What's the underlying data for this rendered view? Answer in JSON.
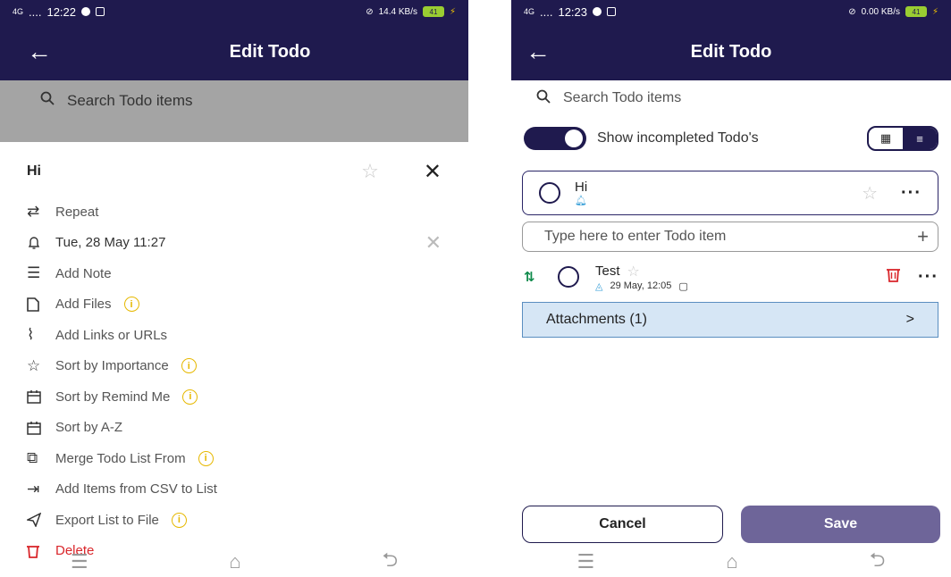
{
  "left": {
    "status": {
      "time": "12:22",
      "network": "4G",
      "signal": "....",
      "battery": "41",
      "speed": "14.4 KB/s"
    },
    "appbar": {
      "title": "Edit Todo"
    },
    "search": {
      "placeholder": "Search Todo items"
    },
    "todo": {
      "name": "Hi"
    },
    "menu": [
      {
        "label": "Repeat",
        "icon": "repeat-icon",
        "info": false
      },
      {
        "label": "Tue, 28 May 11:27",
        "icon": "bell-icon",
        "info": false
      },
      {
        "label": "Add Note",
        "icon": "note-icon",
        "info": false
      },
      {
        "label": "Add Files",
        "icon": "file-icon",
        "info": true
      },
      {
        "label": "Add Links or URLs",
        "icon": "paperclip-icon",
        "info": false
      },
      {
        "label": "Sort by Importance",
        "icon": "star-icon",
        "info": true
      },
      {
        "label": "Sort by Remind Me",
        "icon": "calendar-icon",
        "info": true
      },
      {
        "label": "Sort by A-Z",
        "icon": "calendar-icon",
        "info": false
      },
      {
        "label": "Merge Todo List From",
        "icon": "merge-icon",
        "info": true
      },
      {
        "label": "Add Items from CSV to List",
        "icon": "import-icon",
        "info": false
      },
      {
        "label": "Export List to File",
        "icon": "send-icon",
        "info": true
      },
      {
        "label": "Delete",
        "icon": "trash-icon",
        "info": false
      }
    ]
  },
  "right": {
    "status": {
      "time": "12:23",
      "network": "4G",
      "signal": "....",
      "battery": "41",
      "speed": "0.00 KB/s"
    },
    "appbar": {
      "title": "Edit Todo"
    },
    "search": {
      "placeholder": "Search Todo items"
    },
    "toggle": {
      "label": "Show incompleted Todo's",
      "on": true
    },
    "current_todo": {
      "name": "Hi"
    },
    "entry": {
      "placeholder": "Type here to enter Todo item"
    },
    "item": {
      "name": "Test",
      "reminder": "29 May, 12:05"
    },
    "attachments": {
      "label": "Attachments (1)",
      "chevron": ">"
    },
    "buttons": {
      "cancel": "Cancel",
      "save": "Save"
    }
  },
  "colors": {
    "primary": "#1f1a4e",
    "save": "#6e6599",
    "delete": "#d9262b",
    "info": "#e6b800",
    "sort": "#0f8a4b",
    "attach_bg": "#d6e6f5"
  }
}
